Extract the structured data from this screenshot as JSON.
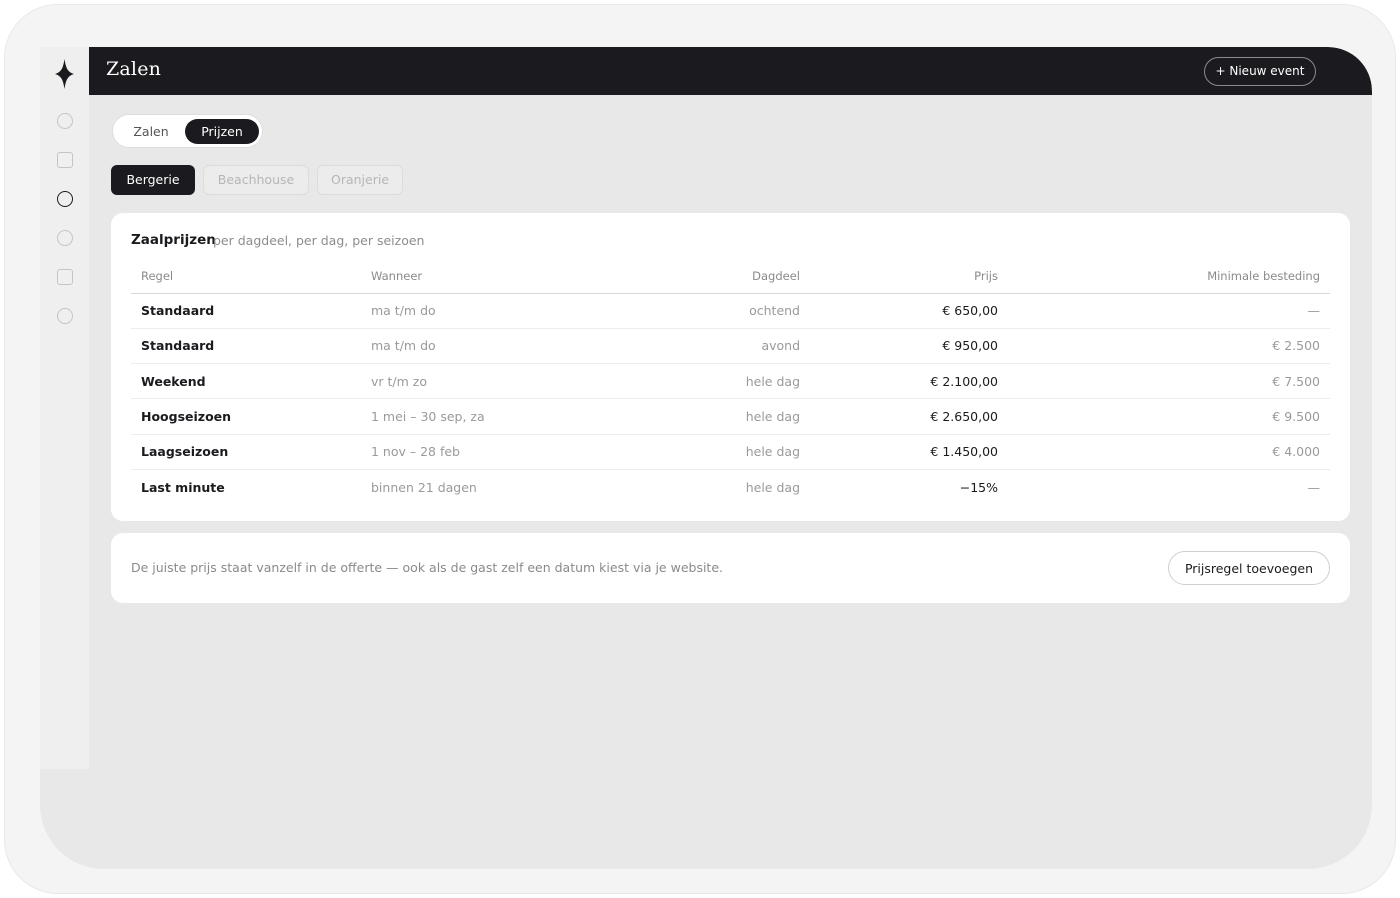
{
  "app": {
    "title": "Zalen",
    "new_event_label": "+ Nieuw event"
  },
  "sidebar": {
    "icons": [
      "circle-icon",
      "square-icon",
      "circle-icon",
      "circle-icon",
      "square-icon",
      "circle-icon"
    ],
    "active_index": 2
  },
  "view_toggle": {
    "options": [
      "Zalen",
      "Prijzen"
    ],
    "selected": "Prijzen"
  },
  "venues": {
    "tabs": [
      "Bergerie",
      "Beachhouse",
      "Oranjerie"
    ],
    "selected": "Bergerie"
  },
  "pricing": {
    "title": "Zaalprijzen",
    "subtitle": "per dagdeel, per dag, per seizoen",
    "columns": [
      "Regel",
      "Wanneer",
      "Dagdeel",
      "Prijs",
      "Minimale besteding"
    ],
    "rows": [
      {
        "rule": "Standaard",
        "when": "ma t/m do",
        "daypart": "ochtend",
        "price": "€ 650,00",
        "min_spend": "—"
      },
      {
        "rule": "Standaard",
        "when": "ma t/m do",
        "daypart": "avond",
        "price": "€ 950,00",
        "min_spend": "€ 2.500"
      },
      {
        "rule": "Weekend",
        "when": "vr t/m zo",
        "daypart": "hele dag",
        "price": "€ 2.100,00",
        "min_spend": "€ 7.500"
      },
      {
        "rule": "Hoogseizoen",
        "when": "1 mei – 30 sep, za",
        "daypart": "hele dag",
        "price": "€ 2.650,00",
        "min_spend": "€ 9.500"
      },
      {
        "rule": "Laagseizoen",
        "when": "1 nov – 28 feb",
        "daypart": "hele dag",
        "price": "€ 1.450,00",
        "min_spend": "€ 4.000"
      },
      {
        "rule": "Last minute",
        "when": "binnen 21 dagen",
        "daypart": "hele dag",
        "price": "−15%",
        "min_spend": "—"
      }
    ]
  },
  "footer": {
    "note": "De juiste prijs staat vanzelf in de offerte — ook als de gast zelf een datum kiest via je website.",
    "add_rule_label": "Prijsregel toevoegen"
  },
  "colors": {
    "dark": "#1b1b1f",
    "avatar": "#d28866",
    "background": "#e8e8e8"
  }
}
